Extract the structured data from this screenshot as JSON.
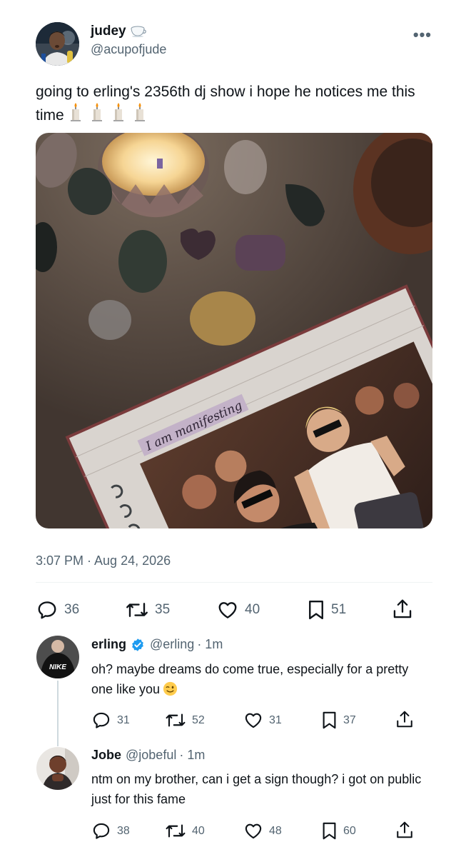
{
  "tweet": {
    "author_name": "judey",
    "author_handle": "@acupofjude",
    "more_label": "•••",
    "text": "going to erling's 2356th dj show i hope he notices me this time",
    "emoji_icons": [
      "candle-icon",
      "candle-icon",
      "candle-icon",
      "candle-icon"
    ],
    "media_caption": "I am manifesting",
    "timestamp": "3:07 PM · Aug 24, 2026",
    "stats": {
      "replies": "36",
      "reposts": "35",
      "likes": "40",
      "bookmarks": "51"
    }
  },
  "replies": [
    {
      "name": "erling",
      "verified": true,
      "handle": "@erling",
      "time": "· 1m",
      "shirt_text": "NIKE",
      "text": "oh? maybe dreams do come true, especially for a pretty one like you",
      "emoji_icon": "winking-face-icon",
      "stats": {
        "replies": "31",
        "reposts": "52",
        "likes": "31",
        "bookmarks": "37"
      }
    },
    {
      "name": "Jobe",
      "verified": false,
      "handle": "@jobeful",
      "time": "· 1m",
      "text": "ntm on my brother, can i get a sign though? i got on public just for this fame",
      "stats": {
        "replies": "38",
        "reposts": "40",
        "likes": "48",
        "bookmarks": "60"
      }
    }
  ],
  "colors": {
    "text": "#0f1419",
    "secondary": "#536471",
    "verified": "#1d9bf0",
    "divider": "#eff3f4"
  }
}
